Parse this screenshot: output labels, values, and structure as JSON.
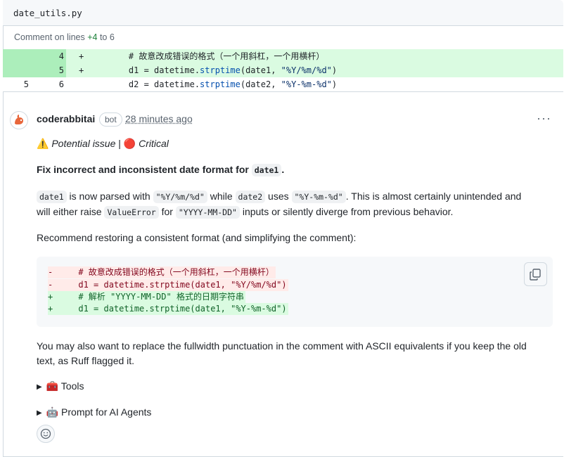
{
  "file": {
    "name": "date_utils.py"
  },
  "lines_note": {
    "prefix": "Comment on lines ",
    "start": "+4",
    "mid": " to ",
    "end": "6"
  },
  "diff": {
    "rows": [
      {
        "type": "add",
        "old": "",
        "new": "4",
        "sign": "+",
        "code": "    # 故意改成错误的格式（一个用斜杠，一个用横杆）"
      },
      {
        "type": "add",
        "old": "",
        "new": "5",
        "sign": "+",
        "code_a": "    d1 = datetime.",
        "code_fn": "strptime",
        "code_b": "(date1, ",
        "code_str": "\"%Y/%m/%d\"",
        "code_c": ")"
      },
      {
        "type": "ctx",
        "old": "5",
        "new": "6",
        "sign": "",
        "code_a": "    d2 = datetime.",
        "code_fn": "strptime",
        "code_b": "(date2, ",
        "code_str": "\"%Y-%m-%d\"",
        "code_c": ")"
      }
    ]
  },
  "comment": {
    "author": "coderabbitai",
    "badge": "bot",
    "time": "28 minutes ago",
    "menu": "···",
    "issue_line": {
      "warn_emoji": "⚠️",
      "potential": "Potential issue",
      "sep": " | ",
      "crit_emoji": "🔴",
      "critical": "Critical"
    },
    "heading": {
      "text": "Fix incorrect and inconsistent date format for ",
      "code": "date1",
      "end": "."
    },
    "para1": {
      "c1": "date1",
      "t1": " is now parsed with ",
      "c2": "\"%Y/%m/%d\"",
      "t2": " while ",
      "c3": "date2",
      "t3": " uses ",
      "c4": "\"%Y-%m-%d\"",
      "t4": ". This is almost certainly unintended and",
      "t5": "will either raise ",
      "c5": "ValueError",
      "t6": " for ",
      "c6": "\"YYYY-MM-DD\"",
      "t7": " inputs or silently diverge from previous behavior."
    },
    "para2": "Recommend restoring a consistent format (and simplifying the comment):",
    "code_lines": [
      {
        "kind": "del",
        "text": "-     # 故意改成错误的格式（一个用斜杠，一个用横杆）"
      },
      {
        "kind": "del",
        "text": "-     d1 = datetime.strptime(date1, \"%Y/%m/%d\")"
      },
      {
        "kind": "ins",
        "text": "+     # 解析 \"YYYY-MM-DD\" 格式的日期字符串"
      },
      {
        "kind": "ins",
        "text": "+     d1 = datetime.strptime(date1, \"%Y-%m-%d\")"
      }
    ],
    "para3_l1": "You may also want to replace the fullwidth punctuation in the comment with ASCII equivalents if you keep the old",
    "para3_l2": "text, as Ruff flagged it.",
    "tools": {
      "emoji": "🧰",
      "label": "Tools"
    },
    "prompt": {
      "emoji": "🤖",
      "label": "Prompt for AI Agents"
    }
  },
  "colors": {
    "add_bg": "#dafbe1",
    "add_gutter": "#aceebb",
    "accent_green": "#1a7f37",
    "del_bg": "#ffebe9"
  }
}
